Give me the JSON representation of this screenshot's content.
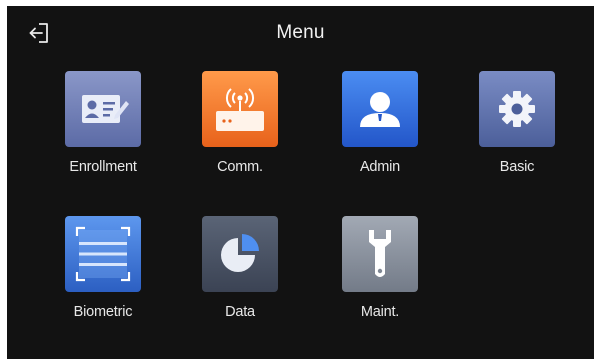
{
  "header": {
    "title": "Menu",
    "back_icon": "exit-back-icon"
  },
  "menu": {
    "items": [
      {
        "label": "Enrollment",
        "icon": "user-card-icon",
        "color": "#6f7fb8"
      },
      {
        "label": "Comm.",
        "icon": "router-wifi-icon",
        "color": "#f07a2c"
      },
      {
        "label": "Admin",
        "icon": "admin-user-icon",
        "color": "#2f6fe0"
      },
      {
        "label": "Basic",
        "icon": "gear-icon",
        "color": "#5a6fa8"
      },
      {
        "label": "Biometric",
        "icon": "scan-frame-icon",
        "color": "#3c78d8"
      },
      {
        "label": "Data",
        "icon": "pie-chart-icon",
        "color": "#4a5466"
      },
      {
        "label": "Maint.",
        "icon": "wrench-icon",
        "color": "#8a929e"
      }
    ]
  },
  "colors": {
    "background": "#121212",
    "text": "#e8e8e8"
  }
}
